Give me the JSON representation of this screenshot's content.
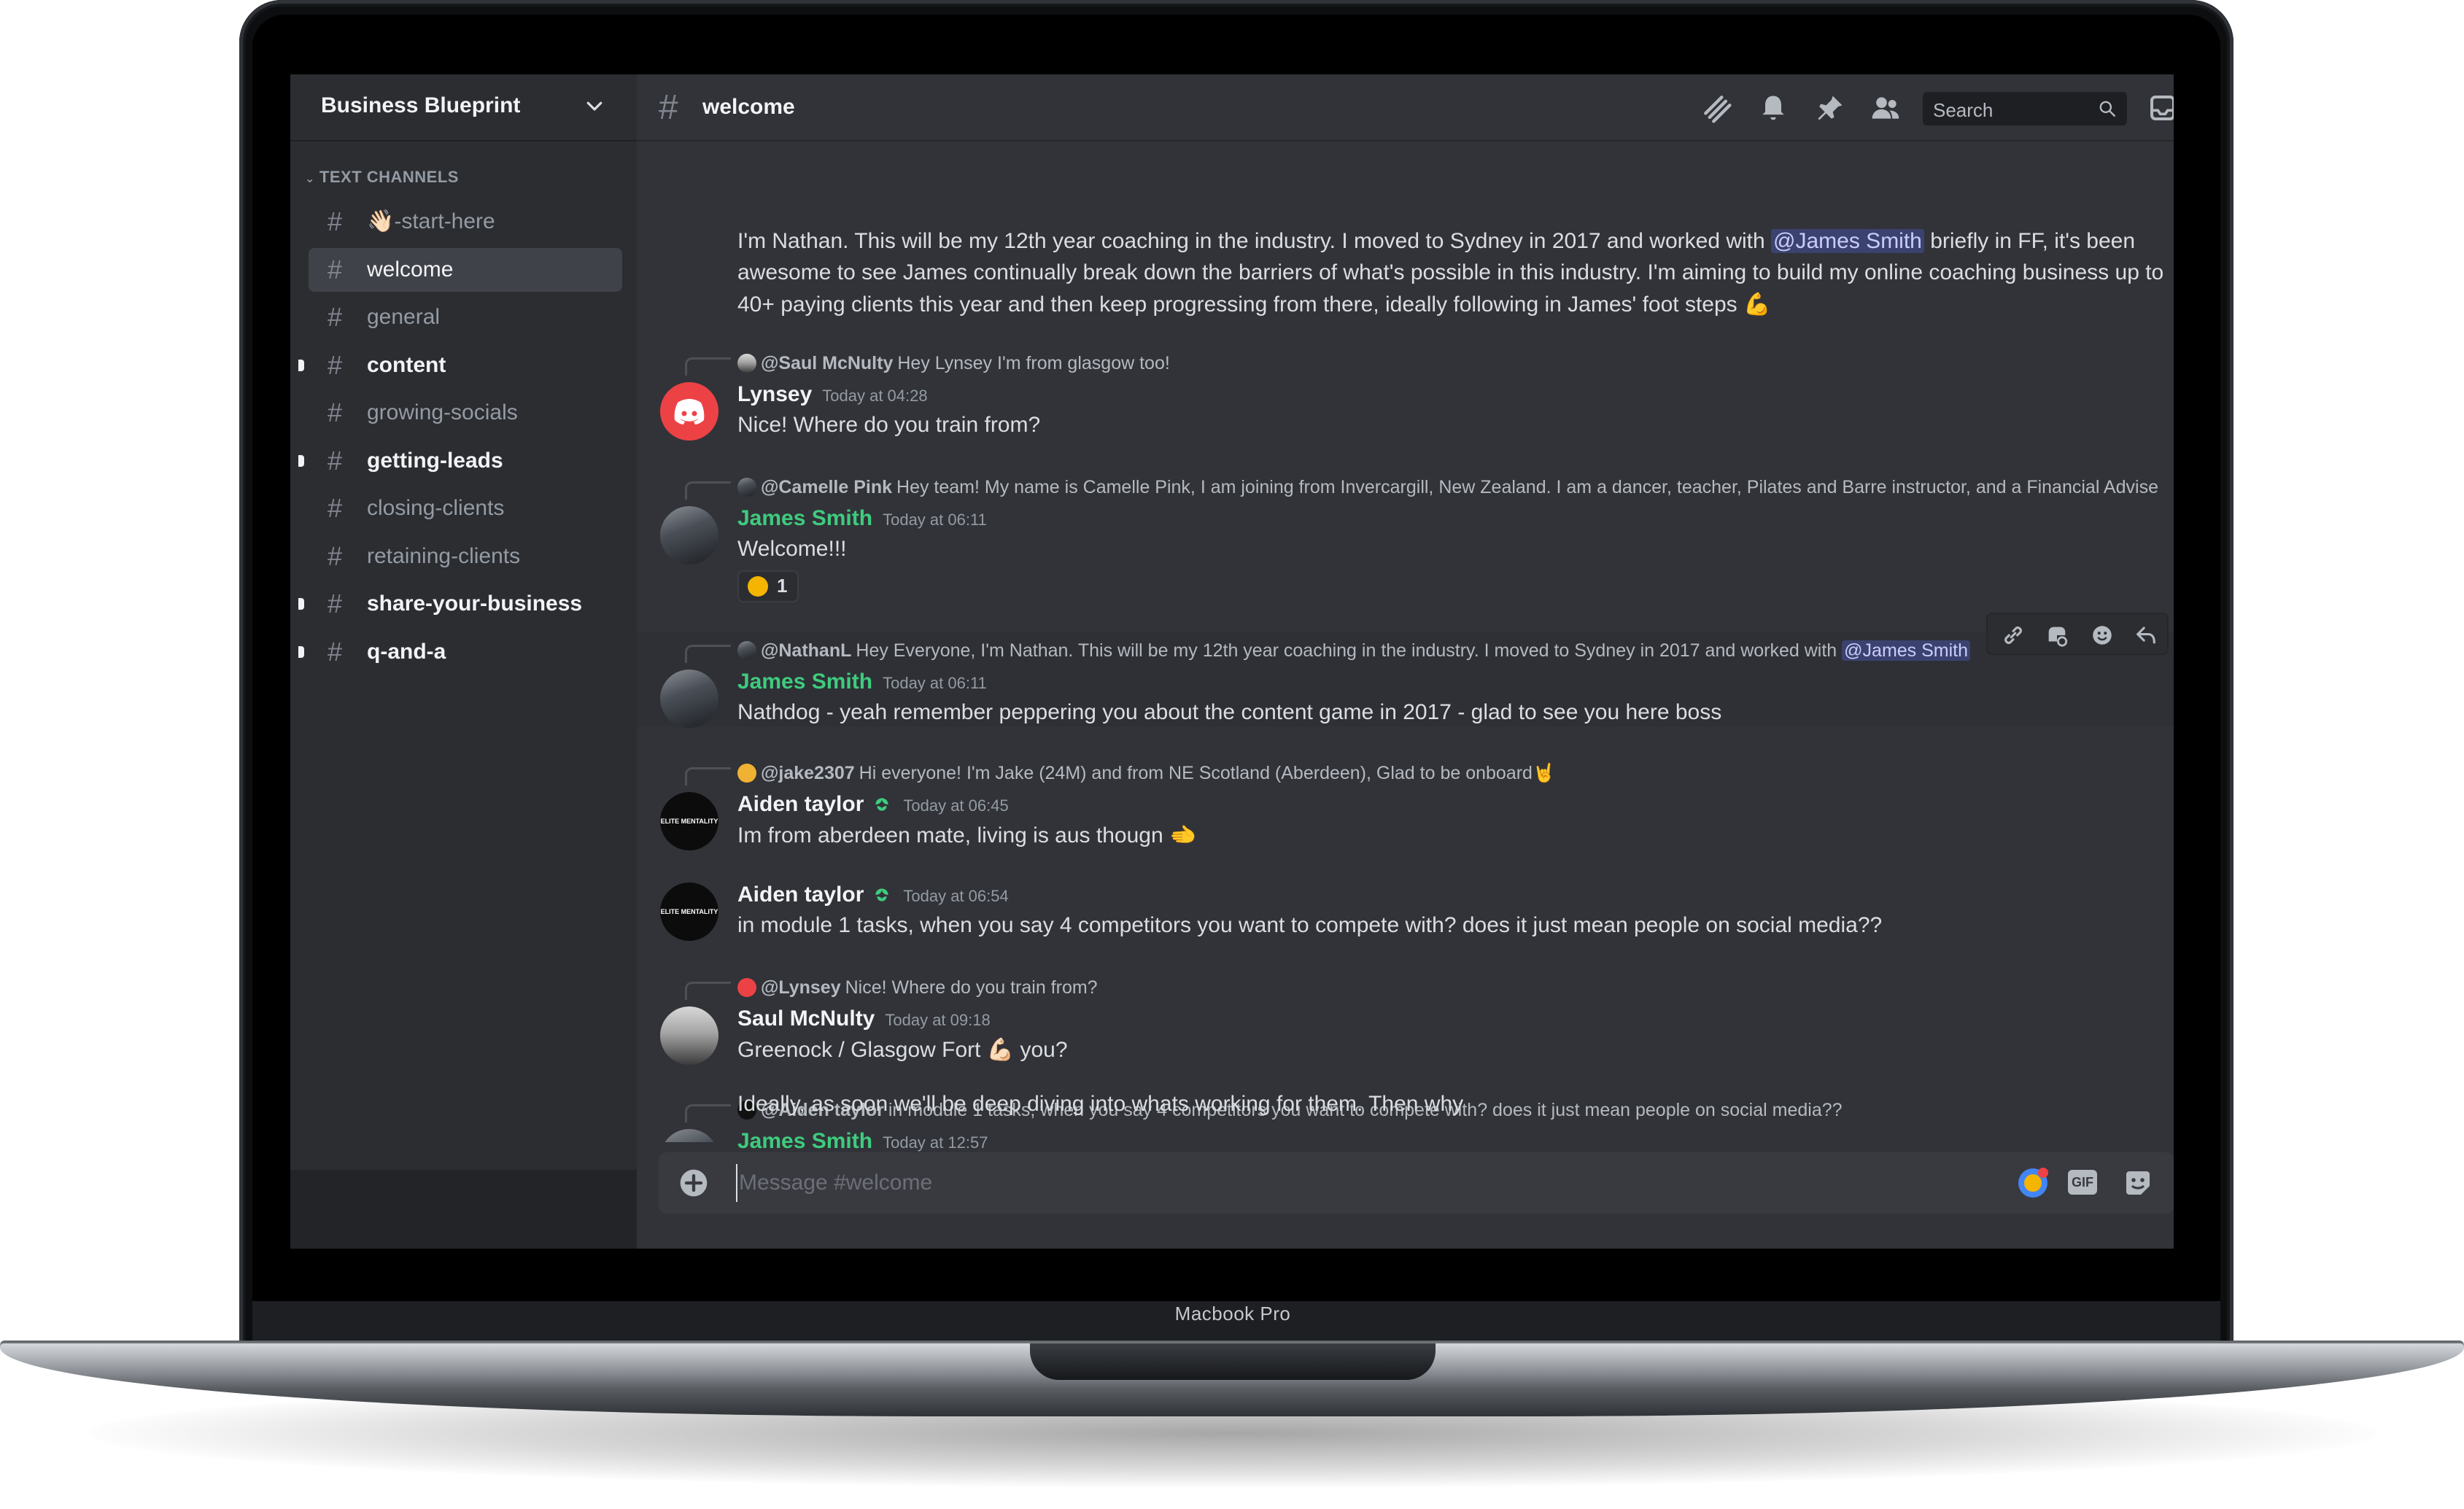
{
  "device": {
    "label": "Macbook Pro"
  },
  "server": {
    "name": "Business Blueprint"
  },
  "category": {
    "label": "TEXT CHANNELS"
  },
  "channels": [
    {
      "label": "👋🏻-start-here",
      "state": "normal"
    },
    {
      "label": "welcome",
      "state": "active"
    },
    {
      "label": "general",
      "state": "normal"
    },
    {
      "label": "content",
      "state": "unread"
    },
    {
      "label": "growing-socials",
      "state": "normal"
    },
    {
      "label": "getting-leads",
      "state": "unread"
    },
    {
      "label": "closing-clients",
      "state": "normal"
    },
    {
      "label": "retaining-clients",
      "state": "normal"
    },
    {
      "label": "share-your-business",
      "state": "unread"
    },
    {
      "label": "q-and-a",
      "state": "unread"
    }
  ],
  "topbar": {
    "channel": "welcome",
    "search_placeholder": "Search"
  },
  "messages": {
    "intro": {
      "line1_a": "I'm Nathan. This will be my 12th year coaching in the industry. I moved to Sydney in 2017 and worked with ",
      "mention": "@James Smith",
      "line1_b": " briefly in FF, it's been",
      "line2": "awesome to see James continually break down the barriers of what's possible in this industry. I'm aiming to build my online coaching business up to",
      "line3": "40+ paying clients this year and then keep progressing from there, ideally following in James' foot steps 💪"
    },
    "m1": {
      "reply_user": "@Saul McNulty",
      "reply_text": "Hey Lynsey I'm from glasgow too!",
      "author": "Lynsey",
      "time": "Today at 04:28",
      "text": "Nice! Where do you train from?"
    },
    "m2": {
      "reply_user": "@Camelle Pink",
      "reply_text": "Hey team! My name is Camelle Pink, I am joining from Invercargill, New Zealand. I am a dancer, teacher, Pilates and Barre instructor, and a Financial Advise",
      "author": "James Smith",
      "time": "Today at 06:11",
      "text": "Welcome!!!",
      "reaction_count": "1"
    },
    "m3": {
      "reply_user": "@NathanL",
      "reply_text": "Hey Everyone, I'm Nathan. This will be my 12th year coaching in the industry. I moved to Sydney in 2017 and worked with ",
      "reply_mention": "@James Smith",
      "author": "James Smith",
      "time": "Today at 06:11",
      "text": "Nathdog - yeah remember peppering you about the content game in 2017 - glad to see you here boss"
    },
    "m4": {
      "reply_user": "@jake2307",
      "reply_text": "Hi everyone! I'm Jake (24M) and from NE Scotland (Aberdeen), Glad to be onboard🤘",
      "author": "Aiden taylor",
      "time": "Today at 06:45",
      "text": "Im from aberdeen mate, living is aus thougn 🫲"
    },
    "m5": {
      "author": "Aiden taylor",
      "time": "Today at 06:54",
      "text": "in module 1 tasks, when you say 4 competitors you want to compete with? does it just mean people on social media??"
    },
    "m6": {
      "reply_user": "@Lynsey",
      "reply_text": "Nice! Where do you train from?",
      "author": "Saul McNulty",
      "time": "Today at 09:18",
      "text": "Greenock / Glasgow Fort 💪🏻 you?"
    },
    "m7": {
      "reply_user": "@Aiden taylor",
      "reply_text": "in module 1 tasks, when you say 4 competitors you want to compete with? does it just mean people on social media??",
      "author": "James Smith",
      "time": "Today at 12:57",
      "text": "Ideally, as soon we'll be deep diving into whats working for them. Then why"
    }
  },
  "avatar_text": {
    "elite": "ELITE MENTALITY"
  },
  "composer": {
    "placeholder": "Message #welcome",
    "gif_label": "GIF"
  },
  "icons": {
    "topbar": [
      "threads-icon",
      "bell-icon",
      "pin-icon",
      "members-icon",
      "search-icon",
      "inbox-icon"
    ],
    "hover_toolbar": [
      "link-icon",
      "thread-icon",
      "add-reaction-icon",
      "reply-icon"
    ],
    "composer": [
      "plus-icon",
      "nitro-icon",
      "gif-icon",
      "sticker-icon"
    ]
  },
  "colors": {
    "accent_green": "#3fcb7e",
    "mention_bg": "#3c4270",
    "discord_red": "#ed4245",
    "background": "#313338",
    "sidebar": "#2b2d31"
  }
}
